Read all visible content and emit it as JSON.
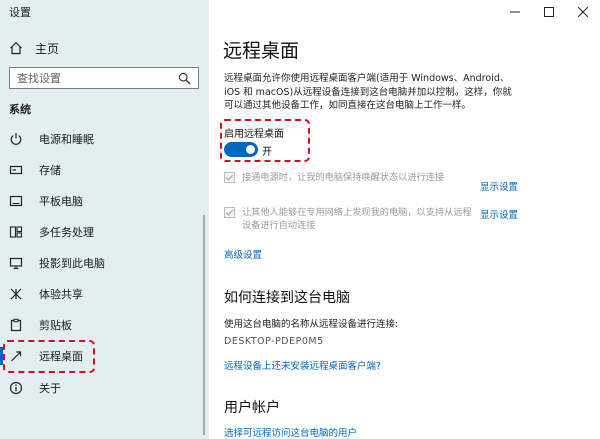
{
  "window": {
    "title": "设置"
  },
  "sidebar": {
    "home_label": "主页",
    "search_placeholder": "查找设置",
    "section_title": "系统",
    "items": [
      {
        "label": "电源和睡眠",
        "icon": "power-icon"
      },
      {
        "label": "存储",
        "icon": "storage-icon"
      },
      {
        "label": "平板电脑",
        "icon": "tablet-icon"
      },
      {
        "label": "多任务处理",
        "icon": "multitasking-icon"
      },
      {
        "label": "投影到此电脑",
        "icon": "project-icon"
      },
      {
        "label": "体验共享",
        "icon": "share-icon"
      },
      {
        "label": "剪贴板",
        "icon": "clipboard-icon"
      },
      {
        "label": "远程桌面",
        "icon": "remote-desktop-icon",
        "active": true
      },
      {
        "label": "关于",
        "icon": "info-icon"
      }
    ]
  },
  "main": {
    "title": "远程桌面",
    "description": "远程桌面允许你使用远程桌面客户端(适用于 Windows、Android、iOS 和 macOS)从远程设备连接到这台电脑并加以控制。这样，你就可以通过其他设备工作，如同直接在这台电脑上工作一样。",
    "toggle": {
      "label": "启用远程桌面",
      "state_text": "开",
      "on": true
    },
    "option1": {
      "text": "接通电源时，让我的电脑保持唤醒状态以进行连接",
      "link": "显示设置",
      "checked": true,
      "enabled": false
    },
    "option2": {
      "text": "让其他人能够在专用网络上发现我的电脑，以支持从远程设备进行自动连接",
      "link": "显示设置",
      "checked": true,
      "enabled": false
    },
    "advanced_link": "高级设置",
    "how_to_connect": {
      "heading": "如何连接到这台电脑",
      "instruction": "使用这台电脑的名称从远程设备进行连接:",
      "pc_name": "DESKTOP-PDEP0M5",
      "client_link": "远程设备上还未安装远程桌面客户端?"
    },
    "user_accounts": {
      "heading": "用户帐户",
      "link": "选择可远程访问这台电脑的用户"
    }
  },
  "colors": {
    "accent": "#0067c0",
    "sidebar_bg": "#e3eef3",
    "annotation_red": "#d40e1e"
  }
}
